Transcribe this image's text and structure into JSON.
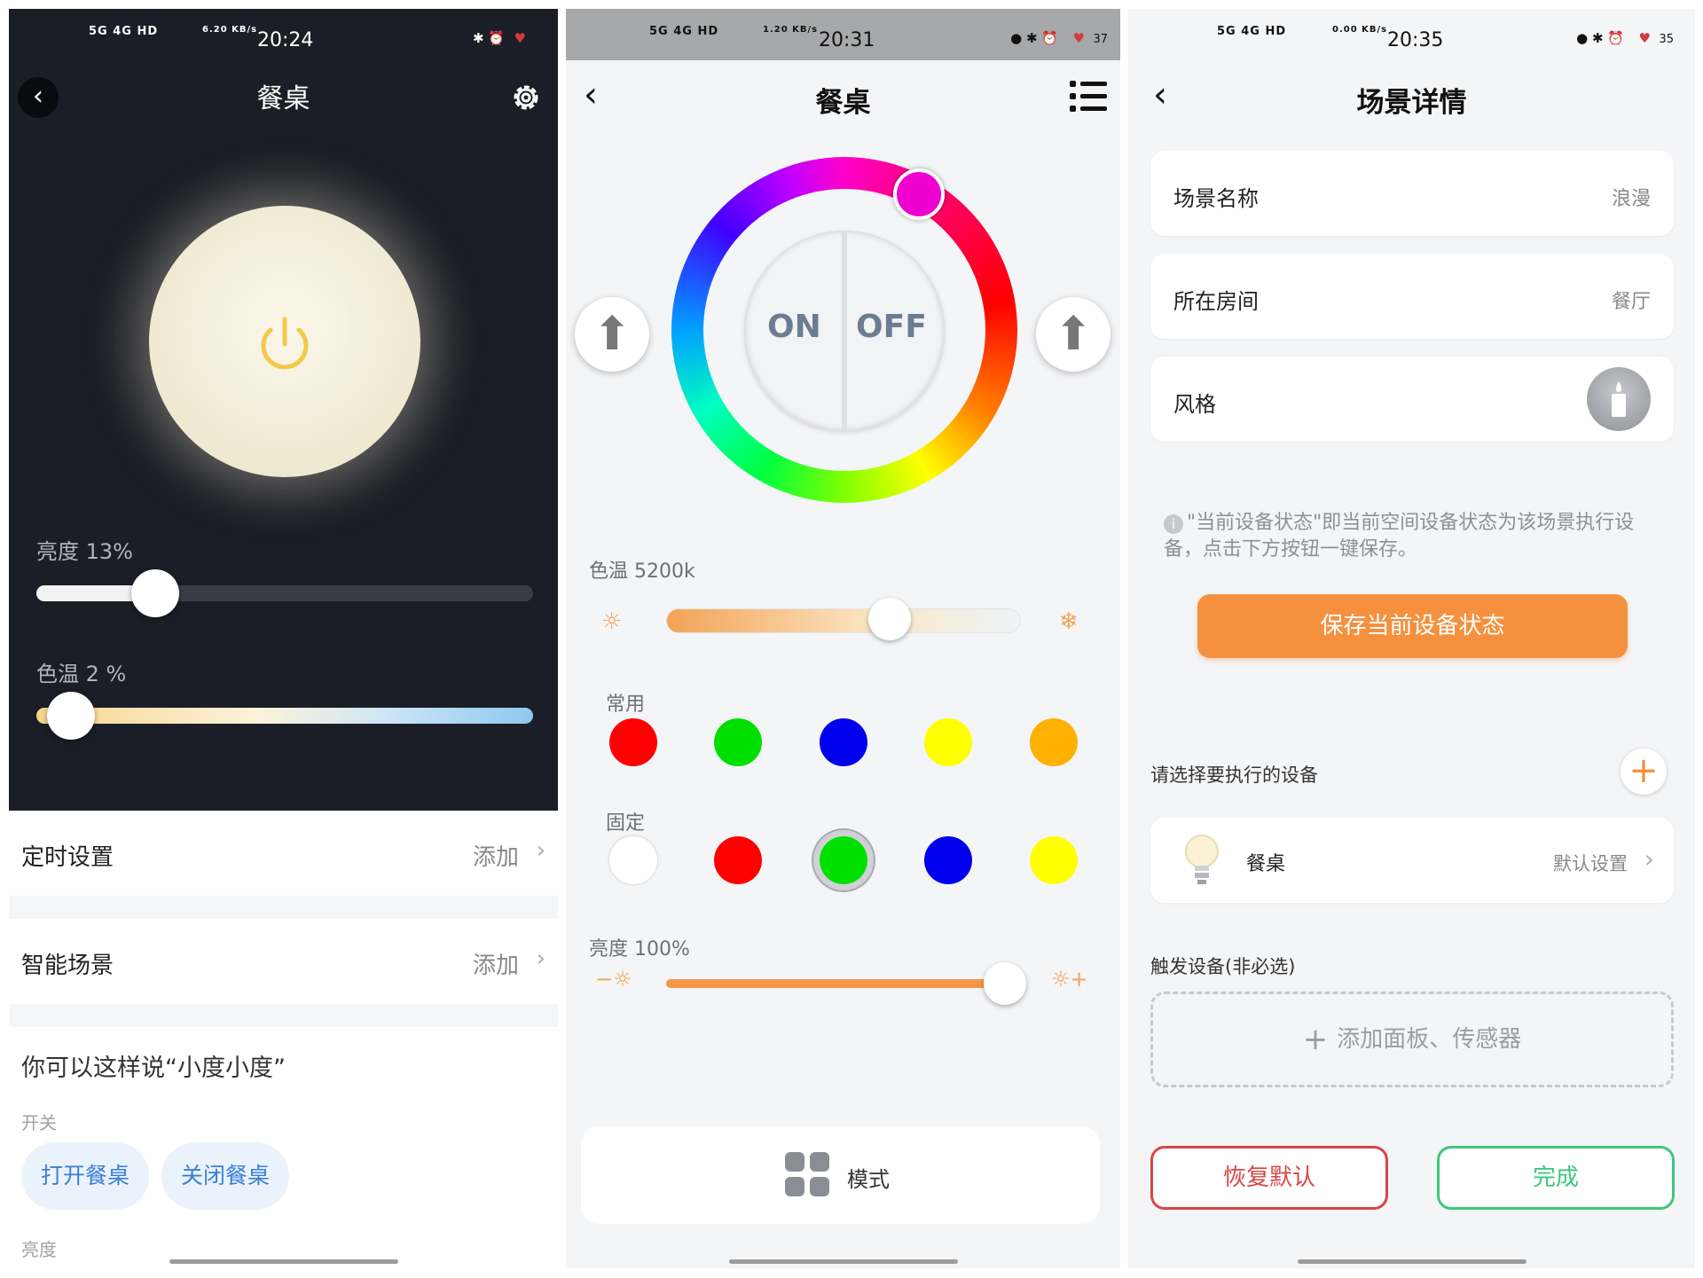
{
  "panel1": {
    "status": {
      "network": "5G 4G HD",
      "speed": "6.20 KB/s",
      "time": "20:24"
    },
    "title": "餐桌",
    "lamp_power": "on",
    "brightness": {
      "label": "亮度 13%",
      "value_pct": 13
    },
    "color_temp": {
      "label": "色温 2 %",
      "value_pct": 2
    },
    "rows": [
      {
        "name": "定时设置",
        "action": "添加"
      },
      {
        "name": "智能场景",
        "action": "添加"
      }
    ],
    "hint_title": "你可以这样说“小度小度”",
    "category_switch": "开关",
    "commands": [
      "打开餐桌",
      "关闭餐桌"
    ],
    "category_brightness": "亮度"
  },
  "panel2": {
    "status": {
      "network": "5G 4G HD",
      "speed": "1.20 KB/s",
      "time": "20:31",
      "battery": "37"
    },
    "title": "餐桌",
    "on_label": "ON",
    "off_label": "OFF",
    "color_temp_label": "色温 5200k",
    "color_temp_pct": 63,
    "common_label": "常用",
    "common_colors": [
      "#ff0000",
      "#00e000",
      "#0000ee",
      "#ffff00",
      "#ffb000"
    ],
    "fixed_label": "固定",
    "fixed_colors": [
      "#ffffff",
      "#ff0000",
      "#00e000",
      "#0000ee",
      "#ffff00"
    ],
    "fixed_selected_index": 2,
    "brightness_label": "亮度 100%",
    "brightness_pct": 100,
    "minus_sign": "−",
    "plus_sign": "+",
    "mode_label": "模式"
  },
  "panel3": {
    "status": {
      "network": "5G 4G HD",
      "speed": "0.00 KB/s",
      "time": "20:35",
      "battery": "35"
    },
    "title": "场景详情",
    "scene_name_label": "场景名称",
    "scene_name_value": "浪漫",
    "room_label": "所在房间",
    "room_value": "餐厅",
    "style_label": "风格",
    "info_text": "\"当前设备状态\"即当前空间设备状态为该场景执行设备，点击下方按钮一键保存。",
    "save_button": "保存当前设备状态",
    "devices_section": "请选择要执行的设备",
    "device_name": "餐桌",
    "device_setting": "默认设置",
    "trigger_section": "触发设备(非必选)",
    "add_trigger": "添加面板、传感器",
    "restore_button": "恢复默认",
    "done_button": "完成"
  }
}
